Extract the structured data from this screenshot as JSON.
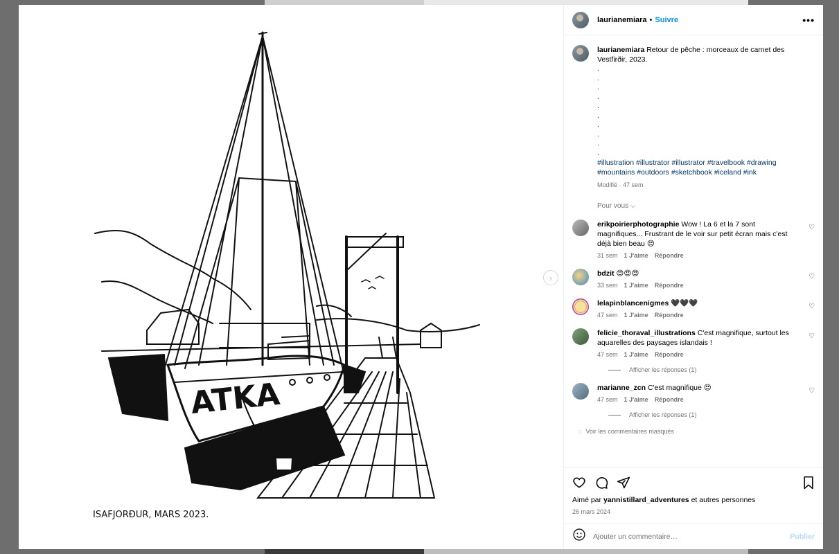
{
  "post": {
    "username": "laurianemiara",
    "follow_label": "Suivre",
    "caption": {
      "username": "laurianemiara",
      "text": "Retour de pêche : morceaux de carnet des Vestfirðir, 2023.",
      "dots": [
        ".",
        ".",
        ".",
        ".",
        ".",
        ".",
        ".",
        ".",
        ".",
        "."
      ],
      "tags_line1": "#illustration #illustrator #illustrator #travelbook #drawing",
      "tags_line2": "#mountains #outdoors #sketchbook #iceland #ink",
      "meta": "Modifié · 47 sem"
    },
    "for_you": "Pour vous",
    "drawing_signature": "ISAFJORÐUR, MARS 2023.",
    "boat_name": "ATKA"
  },
  "comments": [
    {
      "username": "erikpoirierphotographie",
      "text": "Wow ! La 6 et la 7 sont magnifiques... Frustrant de le voir sur petit écran mais c'est déjà bien beau 😍",
      "time": "31 sem",
      "likes": "1 J'aime",
      "reply": "Répondre"
    },
    {
      "username": "bdzit",
      "text": "😍😍😍",
      "time": "33 sem",
      "likes": "1 J'aime",
      "reply": "Répondre"
    },
    {
      "username": "lelapinblancenigmes",
      "text": "🖤🖤🖤",
      "time": "47 sem",
      "likes": "1 J'aime",
      "reply": "Répondre"
    },
    {
      "username": "felicie_thoraval_illustrations",
      "text": "C'est magnifique, surtout les aquarelles des paysages islandais !",
      "time": "47 sem",
      "likes": "1 J'aime",
      "reply": "Répondre",
      "view_replies": "Afficher les réponses (1)"
    },
    {
      "username": "marianne_zcn",
      "text": "C'est magnifique 😍",
      "time": "47 sem",
      "likes": "1 J'aime",
      "reply": "Répondre",
      "view_replies": "Afficher les réponses (1)"
    }
  ],
  "hidden_comments": "Voir les commentaires masqués",
  "liked_by": {
    "prefix": "Aimé par",
    "user": "yannistillard_adventures",
    "suffix": "et autres personnes"
  },
  "date": "26 mars 2024",
  "add_comment": {
    "placeholder": "Ajouter un commentaire…",
    "publish": "Publier"
  },
  "colors": {
    "follow": "#0095f6",
    "tag": "#00376b",
    "muted": "#737373"
  }
}
